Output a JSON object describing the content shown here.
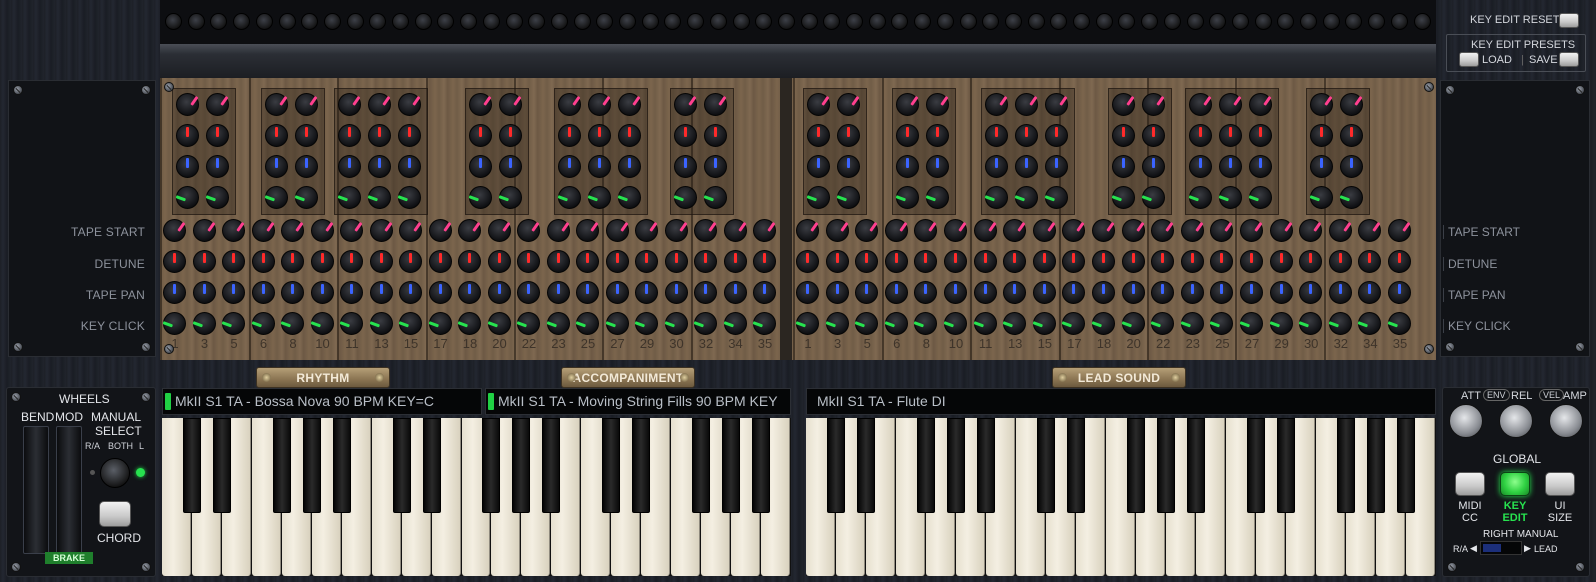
{
  "knob_rows": [
    {
      "label": "TAPE START",
      "color": "#ff3f8e"
    },
    {
      "label": "DETUNE",
      "color": "#ff2a2a"
    },
    {
      "label": "TAPE PAN",
      "color": "#3b64ff"
    },
    {
      "label": "KEY CLICK",
      "color": "#27e24f"
    }
  ],
  "key_edit": {
    "reset_label": "KEY EDIT RESET",
    "presets_label": "KEY EDIT PRESETS",
    "load_label": "LOAD",
    "save_label": "SAVE"
  },
  "key_numbers_left": [
    "1",
    "3",
    "5",
    "6",
    "8",
    "10",
    "11",
    "13",
    "15",
    "17",
    "18",
    "20",
    "22",
    "23",
    "25",
    "27",
    "29",
    "30",
    "32",
    "34",
    "35"
  ],
  "key_numbers_right": [
    "1",
    "3",
    "5",
    "6",
    "8",
    "10",
    "11",
    "13",
    "15",
    "17",
    "18",
    "20",
    "22",
    "23",
    "25",
    "27",
    "29",
    "30",
    "32",
    "34",
    "35"
  ],
  "sections": {
    "rhythm": "RHYTHM",
    "accompaniment": "ACCOMPANIMENT",
    "lead": "LEAD SOUND"
  },
  "displays": {
    "rhythm": "MkII  S1  TA - Bossa Nova 90 BPM KEY=C",
    "accompaniment": "MkII  S1  TA - Moving String Fills 90 BPM KEY",
    "lead": "MkII  S1  TA - Flute DI"
  },
  "wheels": {
    "title": "WHEELS",
    "bend": "BEND",
    "mod": "MOD",
    "manual_select_1": "MANUAL",
    "manual_select_2": "SELECT",
    "ra": "R/A",
    "both": "BOTH",
    "l": "L",
    "chord": "CHORD",
    "brake": "BRAKE"
  },
  "envelope": {
    "att": "ATT",
    "env": "ENV",
    "rel": "REL",
    "vel": "VEL",
    "amp": "AMP"
  },
  "global": {
    "title": "GLOBAL",
    "midi_1": "MIDI",
    "midi_2": "CC",
    "key_1": "KEY",
    "key_2": "EDIT",
    "ui_1": "UI",
    "ui_2": "SIZE",
    "right_manual": "RIGHT MANUAL",
    "ra": "R/A",
    "lead": "LEAD"
  },
  "colors": {
    "led_green": "#27e24f",
    "wood": "#7b654d"
  }
}
